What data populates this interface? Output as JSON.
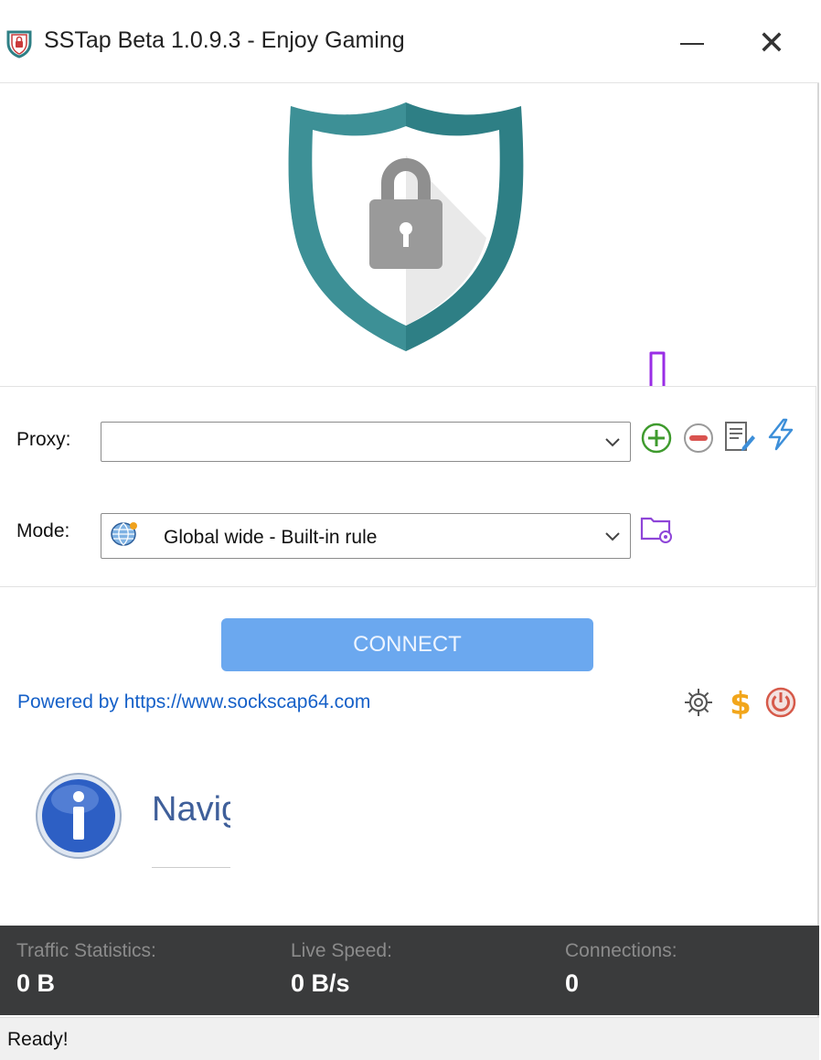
{
  "window": {
    "title": "SSTap Beta 1.0.9.3 - Enjoy Gaming"
  },
  "proxy": {
    "label": "Proxy:",
    "value": ""
  },
  "mode": {
    "label": "Mode:",
    "value": "Global wide - Built-in rule"
  },
  "connect": {
    "label": "CONNECT"
  },
  "footer": {
    "powered_by": "Powered by https://www.sockscap64.com"
  },
  "news": {
    "title": "Navig"
  },
  "stats": {
    "traffic_label": "Traffic Statistics:",
    "traffic_value": "0 B",
    "speed_label": "Live Speed:",
    "speed_value": "0 B/s",
    "connections_label": "Connections:",
    "connections_value": "0"
  },
  "status": {
    "text": "Ready!"
  },
  "icons": {
    "app": "shield-icon",
    "main": "shield-lock-icon",
    "add_proxy": "plus-circle-icon",
    "remove_proxy": "minus-circle-icon",
    "edit_proxy": "edit-document-icon",
    "speed_test": "lightning-icon",
    "mode_globe": "globe-icon",
    "mode_rules": "folder-settings-icon",
    "settings": "gear-icon",
    "donate": "dollar-icon",
    "exit": "power-icon",
    "info": "info-icon",
    "annotation": "arrow-down-icon"
  },
  "colors": {
    "accent_teal": "#2e7f85",
    "connect_button": "#6ba8ef",
    "link": "#1560c8",
    "stats_bar": "#3a3b3c",
    "add_green": "#3f9b2e",
    "remove_red": "#d9534f",
    "annotation_purple": "#9a2ee6"
  }
}
